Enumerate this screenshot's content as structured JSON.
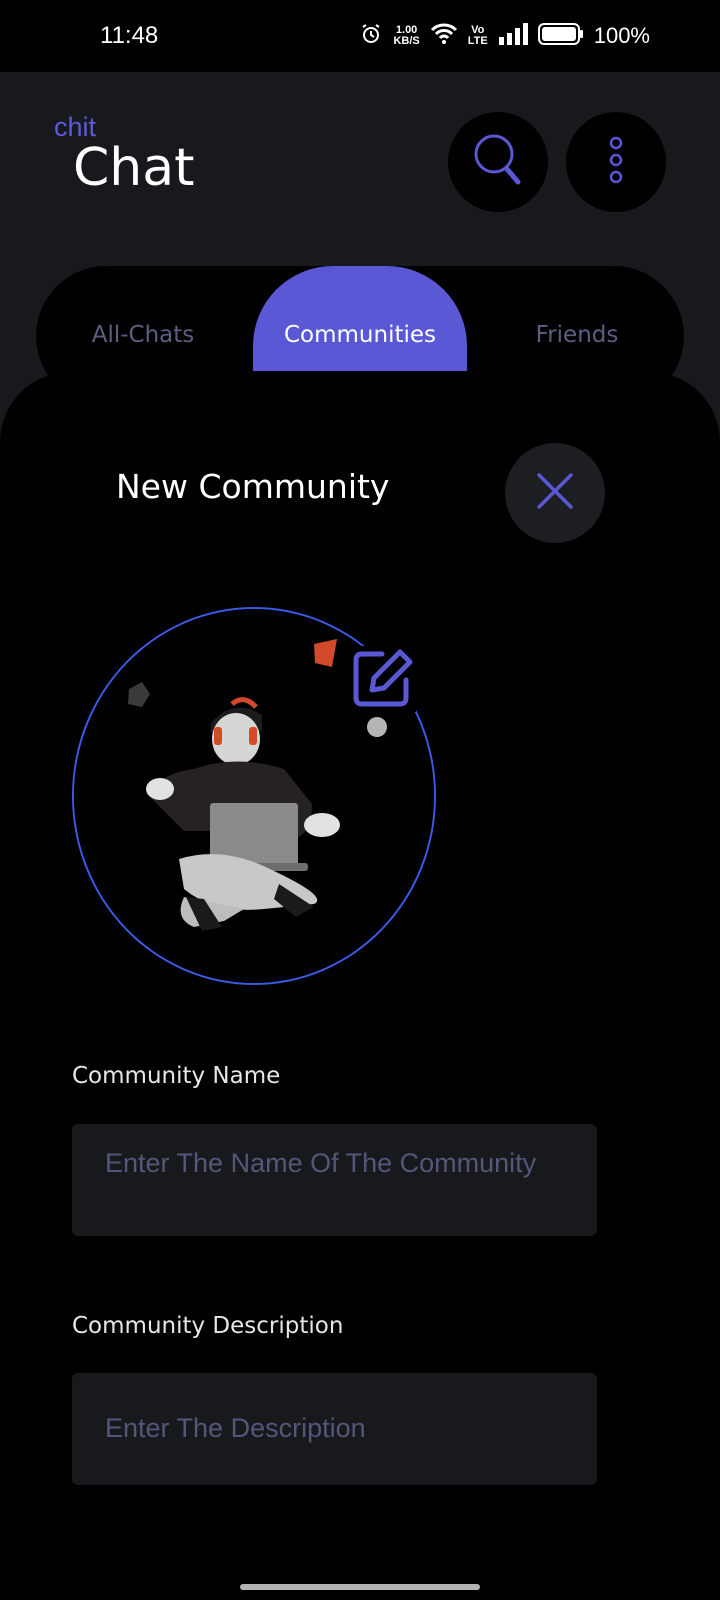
{
  "status_bar": {
    "time": "11:48",
    "net_speed_value": "1.00",
    "net_speed_unit": "KB/S",
    "volte_top": "Vo",
    "volte_bottom": "LTE",
    "battery": "100%"
  },
  "header": {
    "logo_small": "chit",
    "logo_big": "Chat",
    "search_icon": "search-icon",
    "menu_icon": "more-vertical-icon"
  },
  "tabs": {
    "all_chats": "All-Chats",
    "communities": "Communities",
    "friends": "Friends",
    "active": "Communities"
  },
  "sheet": {
    "title": "New Community",
    "close_icon": "close-icon",
    "edit_icon": "edit-icon",
    "name_label": "Community Name",
    "name_placeholder": "Enter The Name Of The Community",
    "description_label": "Community Description",
    "description_placeholder": "Enter The Description"
  },
  "colors": {
    "accent": "#5b58d6",
    "ring": "#3c5be8",
    "background": "#000000",
    "surface": "#18191d",
    "placeholder": "#54567a"
  }
}
